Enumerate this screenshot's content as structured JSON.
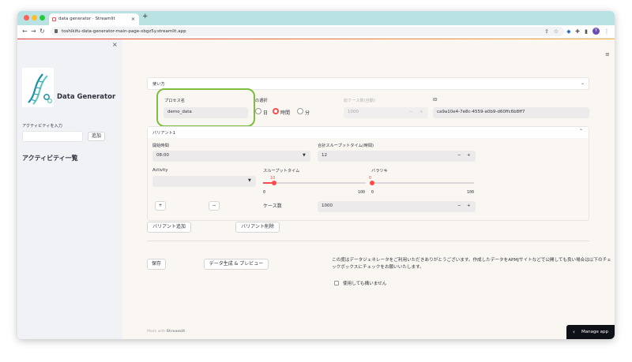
{
  "browser": {
    "tab_title": "data generator · Streamlit",
    "tab_close": "×",
    "new_tab": "+",
    "url": "toshikifu-data-generator-main-page-xbgz5y.streamlit.app",
    "avatar": "Y"
  },
  "sidebar": {
    "close": "×",
    "app_title": "Data Generator",
    "activity_label": "アクティビティを入力",
    "activity_value": "",
    "add_button": "追加",
    "list_heading": "アクティビティ一覧"
  },
  "main": {
    "usage_expander": "使い方",
    "process_label": "プロセス名",
    "process_value": "demo_data",
    "unit_label": "の選択",
    "unit_options": [
      "日",
      "時間",
      "分"
    ],
    "unit_selected": "時間",
    "case_count_auto_label": "総ケース数(自動)",
    "case_count_auto_value": "1000",
    "id_label": "ID",
    "id_value": "ca9a10e4-7e8c-4559-a0b9-d60ffc6b8ff7",
    "variant_expander": "バリアント1",
    "start_time_label": "開始時間",
    "start_time_value": "08:00",
    "total_throughput_label": "合計スループットタイム(時間)",
    "total_throughput_value": "12",
    "activity_label": "Activity",
    "throughput_label": "スループットタイム",
    "throughput_value": "10",
    "throughput_min": "0",
    "throughput_max": "100",
    "variance_label": "バラツキ",
    "variance_value": "0",
    "variance_min": "0",
    "variance_max": "100",
    "plus_button": "+",
    "minus_button": "−",
    "case_count_label": "ケース数",
    "case_count_value": "1000",
    "add_variant": "バリアント追加",
    "delete_variant": "バリアント削除",
    "save_button": "保存",
    "generate_button": "データ生成 & プレビュー",
    "notice_text": "この度はデータジェネレータをご利用いただきありがとうございます。作成したデータをAPMJサイトなどで公開しても良い場合は以下のチェックボックスにチェックをお願いいたします。",
    "consent_label": "使用しても構いません",
    "stepper_minus": "−",
    "stepper_plus": "+",
    "footer_prefix": "Made with",
    "footer_brand": "Streamlit",
    "manage_app": "Manage app",
    "menu_icon": "≡"
  },
  "colors": {
    "accent": "#ff4b4b",
    "highlight_ring": "#7dbd3f",
    "tabbar": "#b9e2e3"
  }
}
